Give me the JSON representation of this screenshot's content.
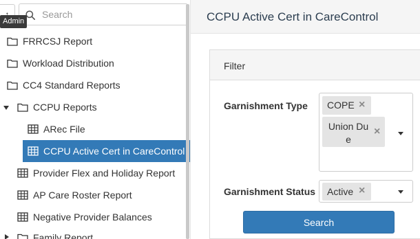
{
  "tree": {
    "up_icon": "arrow-up-icon",
    "tooltip": "Admin",
    "search": {
      "placeholder": "Search",
      "value": ""
    },
    "items": [
      {
        "label": "FRRCSJ Report",
        "icon": "folder-icon"
      },
      {
        "label": "Workload Distribution",
        "icon": "folder-icon"
      },
      {
        "label": "CC4 Standard Reports",
        "icon": "folder-icon"
      },
      {
        "label": "CCPU Reports",
        "icon": "folder-icon",
        "expanded": true
      },
      {
        "label": "ARec File",
        "icon": "table-icon"
      },
      {
        "label": "CCPU Active Cert in CareControl",
        "icon": "table-icon",
        "selected": true
      },
      {
        "label": "Provider Flex and Holiday Report",
        "icon": "table-icon"
      },
      {
        "label": "AP Care Roster Report",
        "icon": "table-icon"
      },
      {
        "label": "Negative Provider Balances",
        "icon": "table-icon"
      },
      {
        "label": "Family Report",
        "icon": "folder-icon",
        "expanded": false
      }
    ]
  },
  "header": {
    "title": "CCPU Active Cert in CareControl"
  },
  "filter": {
    "title": "Filter",
    "garnishment_type": {
      "label": "Garnishment Type",
      "selected": [
        "COPE",
        "Union Due"
      ]
    },
    "garnishment_status": {
      "label": "Garnishment Status",
      "selected": [
        "Active"
      ]
    },
    "search_button": "Search"
  },
  "colors": {
    "accent": "#337ab7",
    "header_bg": "#f5f5f5",
    "chip_bg": "#e4e4e4"
  }
}
